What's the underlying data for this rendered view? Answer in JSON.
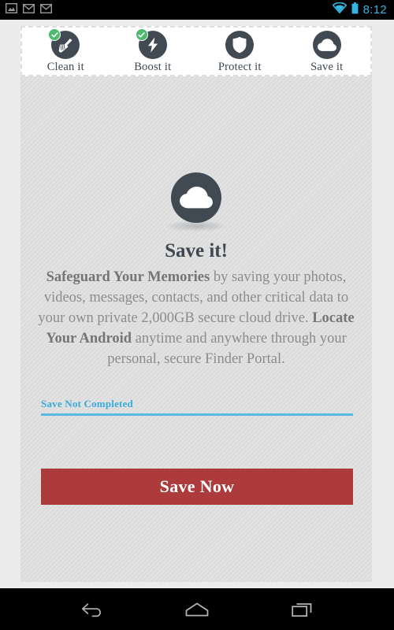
{
  "status_bar": {
    "left_icons": [
      "image-icon",
      "mail-icon",
      "mail-icon"
    ],
    "right_icons": [
      "wifi-icon",
      "battery-icon"
    ],
    "time": "8:12",
    "accent_color": "#33b5e5",
    "background": "#000000"
  },
  "tabs": [
    {
      "label": "Clean it",
      "icon": "broom-icon",
      "completed": true
    },
    {
      "label": "Boost it",
      "icon": "lightning-icon",
      "completed": true
    },
    {
      "label": "Protect it",
      "icon": "shield-icon",
      "completed": false
    },
    {
      "label": "Save it",
      "icon": "cloud-icon",
      "completed": false
    }
  ],
  "hero": {
    "icon": "cloud-icon",
    "title": "Save it!",
    "body_parts": [
      {
        "text": "Safeguard Your Memories",
        "bold": true
      },
      {
        "text": " by saving your photos, videos, messages, contacts, and other critical data to your own private 2,000GB secure cloud drive. ",
        "bold": false
      },
      {
        "text": "Locate Your Android",
        "bold": true
      },
      {
        "text": " anytime and anywhere through your personal, secure Finder Portal.",
        "bold": false
      }
    ]
  },
  "progress": {
    "label": "Save Not Completed",
    "value": 0,
    "bar_color": "#59b9e3",
    "label_color": "#3aabdd"
  },
  "cta": {
    "label": "Save Now",
    "color": "#ad3b3b"
  },
  "nav_bar": {
    "buttons": [
      {
        "name": "back-icon"
      },
      {
        "name": "home-icon"
      },
      {
        "name": "recents-icon"
      }
    ]
  }
}
